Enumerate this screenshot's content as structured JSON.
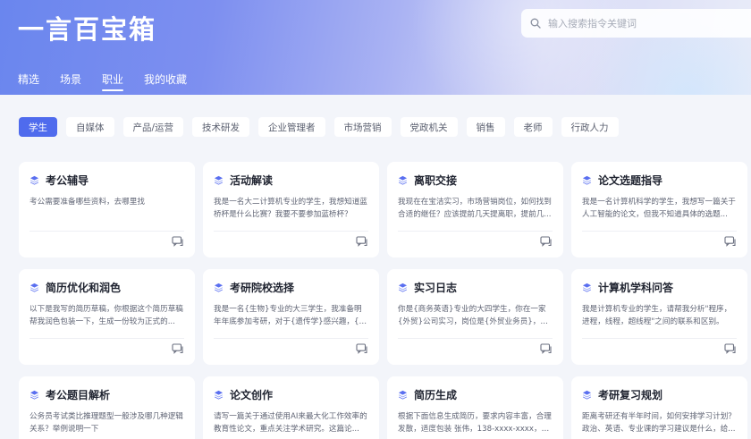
{
  "app": {
    "title": "一言百宝箱"
  },
  "search": {
    "placeholder": "输入搜索指令关键词"
  },
  "main_tabs": [
    {
      "label": "精选"
    },
    {
      "label": "场景"
    },
    {
      "label": "职业",
      "active": true
    },
    {
      "label": "我的收藏"
    }
  ],
  "categories": [
    {
      "label": "学生",
      "active": true
    },
    {
      "label": "自媒体"
    },
    {
      "label": "产品/运营"
    },
    {
      "label": "技术研发"
    },
    {
      "label": "企业管理者"
    },
    {
      "label": "市场营销"
    },
    {
      "label": "党政机关"
    },
    {
      "label": "销售"
    },
    {
      "label": "老师"
    },
    {
      "label": "行政人力"
    }
  ],
  "cards": [
    {
      "title": "考公辅导",
      "desc": "考公需要准备哪些资料，去哪里找"
    },
    {
      "title": "活动解读",
      "desc": "我是一名大二计算机专业的学生，我想知道蓝桥杯是什么比赛？我要不要参加蓝桥杯？"
    },
    {
      "title": "离职交接",
      "desc": "我现在在宝洁实习，市场营销岗位，如何找到合适的继任？应该提前几天提离职，提前几..."
    },
    {
      "title": "论文选题指导",
      "desc": "我是一名计算机科学的学生，我想写一篇关于人工智能的论文，但我不知道具体的选题..."
    },
    {
      "title": "简历优化和润色",
      "desc": "以下是我写的简历草稿，你根据这个简历草稿帮我润色包装一下，生成一份较为正式的..."
    },
    {
      "title": "考研院校选择",
      "desc": "我是一名{生物}专业的大三学生，我准备明年年底参加考研，对于{遗传学}感兴趣，{但是..."
    },
    {
      "title": "实习日志",
      "desc": "你是{商务英语}专业的大四学生，你在一家{外贸}公司实习，岗位是{外贸业务员}，现在请..."
    },
    {
      "title": "计算机学科问答",
      "desc": "我是计算机专业的学生，请帮我分析\"程序，进程，线程，超线程\"之间的联系和区别。"
    },
    {
      "title": "考公题目解析",
      "desc": "公务员考试类比推理题型一般涉及哪几种逻辑关系？举例说明一下"
    },
    {
      "title": "论文创作",
      "desc": "请写一篇关于通过使用AI来最大化工作效率的教育性论文，重点关注学术研究。这篇论..."
    },
    {
      "title": "简历生成",
      "desc": "根据下面信息生成简历，要求内容丰富，合理发散，适度包装 张伟，138-xxxx-xxxx，zha..."
    },
    {
      "title": "考研复习规划",
      "desc": "距离考研还有半年时间，如何安排学习计划？政治、英语、专业课的学习建议是什么，给..."
    }
  ],
  "colors": {
    "accent": "#4f6bed",
    "card_icon": "#5a6ff0"
  }
}
